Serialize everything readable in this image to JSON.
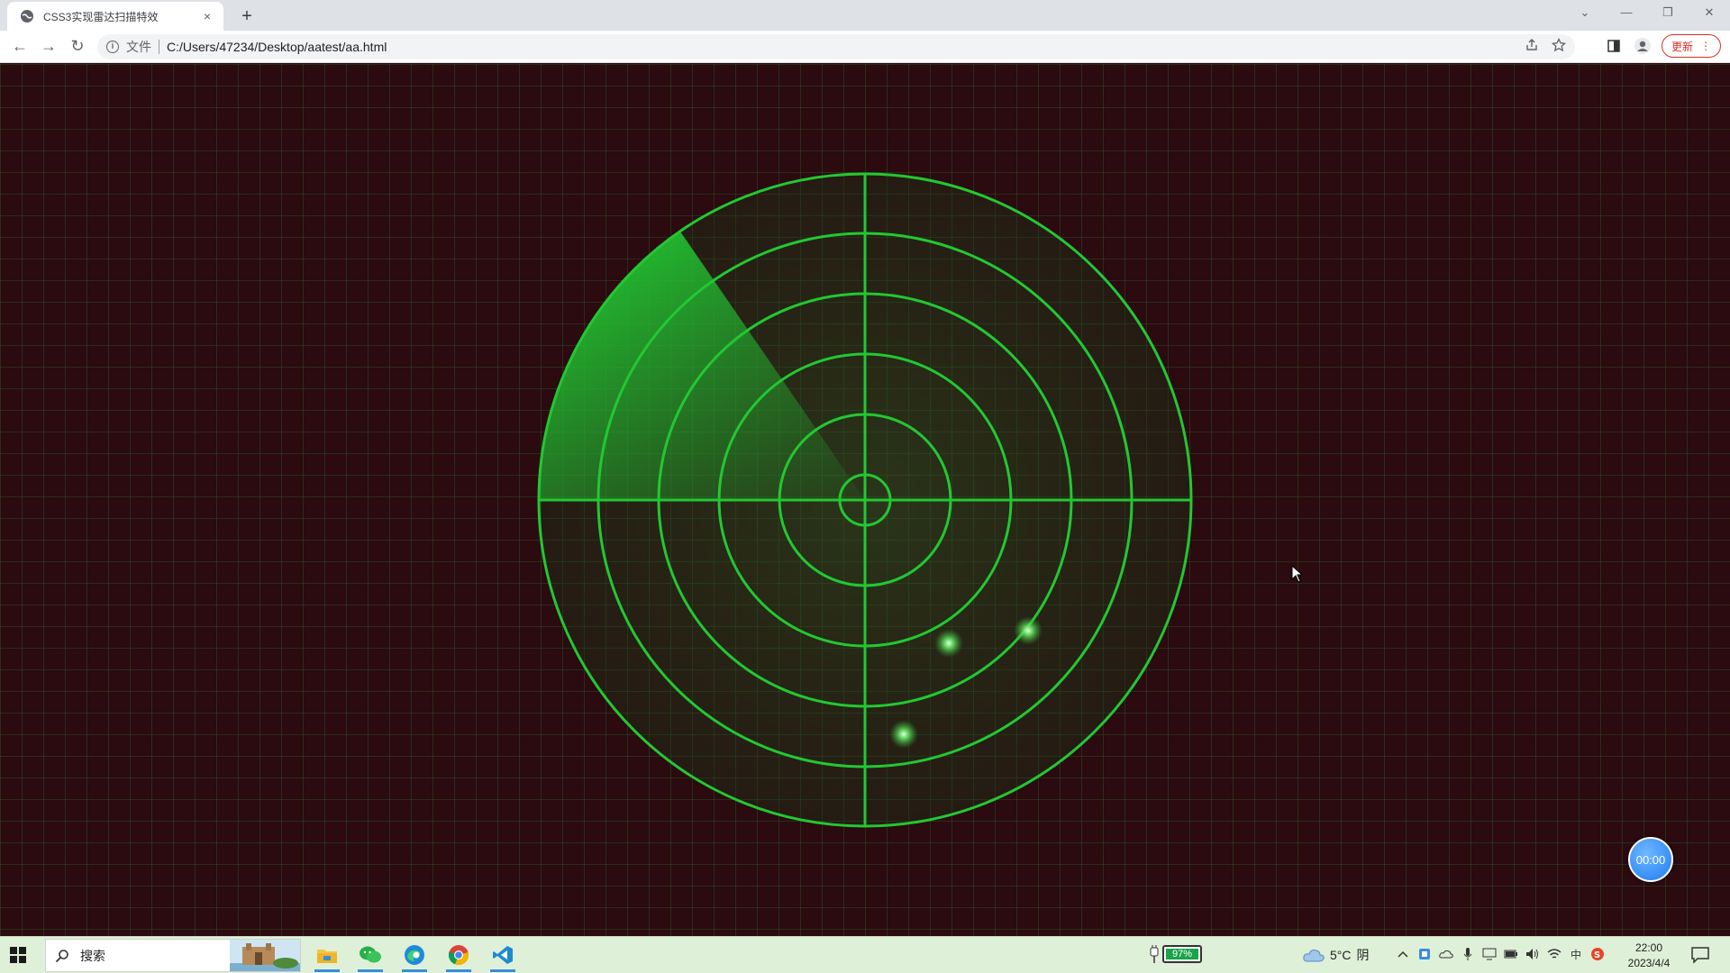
{
  "browser": {
    "tab_title": "CSS3实现雷达扫描特效",
    "tab_close": "×",
    "new_tab": "+",
    "window_controls": {
      "dropdown": "⌄",
      "minimize": "—",
      "restore": "❐",
      "close": "✕"
    },
    "nav": {
      "back": "←",
      "forward": "→",
      "reload": "↻"
    },
    "address": {
      "scheme_label": "文件",
      "url": "C:/Users/47234/Desktop/aatest/aa.html",
      "info": "i"
    },
    "update_label": "更新",
    "update_menu": "⋮"
  },
  "page": {
    "timer": "00:00"
  },
  "radar": {
    "accent": "#22c832",
    "background": "#2b0a10"
  },
  "taskbar": {
    "search_placeholder": "搜索",
    "battery_percent": "97%",
    "weather_temp": "5°C",
    "weather_desc": "阴",
    "time": "22:00",
    "date": "2023/4/4",
    "apps": [
      "file-explorer-icon",
      "wechat-icon",
      "edge-icon",
      "chrome-icon",
      "vscode-icon"
    ]
  }
}
